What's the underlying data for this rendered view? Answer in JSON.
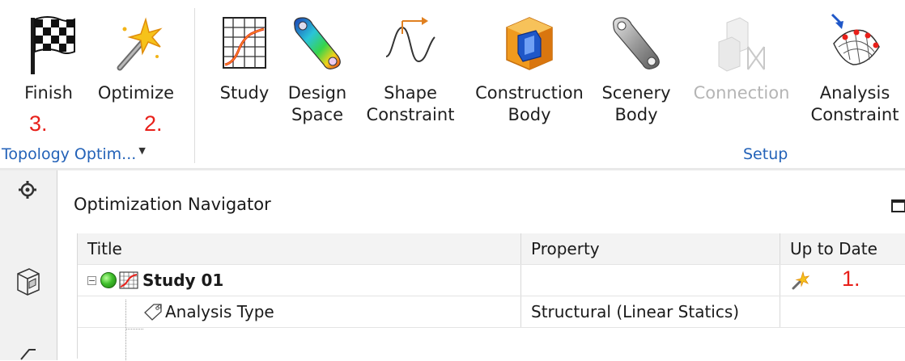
{
  "ribbon": {
    "buttons": [
      {
        "id": "finish",
        "label": "Finish"
      },
      {
        "id": "optimize",
        "label": "Optimize"
      },
      {
        "id": "study",
        "label": "Study"
      },
      {
        "id": "design_space",
        "label": "Design\nSpace"
      },
      {
        "id": "shape_constraint",
        "label": "Shape\nConstraint"
      },
      {
        "id": "construction_body",
        "label": "Construction\nBody"
      },
      {
        "id": "scenery_body",
        "label": "Scenery\nBody"
      },
      {
        "id": "connection",
        "label": "Connection",
        "disabled": true
      },
      {
        "id": "analysis_constraint",
        "label": "Analysis\nConstraint"
      }
    ],
    "groups": {
      "topology": "Topology Optim...",
      "setup": "Setup"
    },
    "annotations": {
      "finish_step": "3.",
      "optimize_step": "2.",
      "uptodate_step": "1."
    }
  },
  "navigator": {
    "title": "Optimization Navigator",
    "columns": [
      "Title",
      "Property",
      "Up to Date"
    ],
    "rows": [
      {
        "title": "Study 01",
        "property": "",
        "up_to_date_icon": "optimize-wand-icon"
      },
      {
        "title": "Analysis Type",
        "property": "Structural (Linear Statics)",
        "up_to_date_icon": ""
      }
    ]
  },
  "colors": {
    "group_label": "#2362b8",
    "annotation_red": "#e8201a",
    "disabled_text": "#b5b5b5"
  }
}
